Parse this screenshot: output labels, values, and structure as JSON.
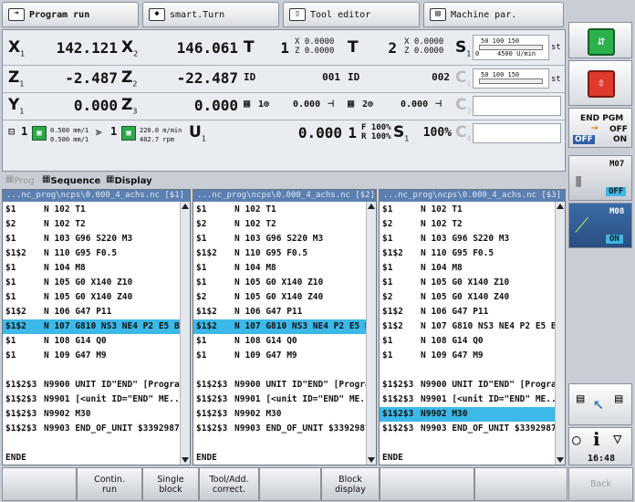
{
  "tabs": [
    {
      "label": "Program run",
      "icon": "arrow-right-icon",
      "active": true
    },
    {
      "label": "smart.Turn",
      "icon": "diamond-arrow-icon",
      "active": false
    },
    {
      "label": "Tool editor",
      "icon": "tool-icon",
      "active": false
    },
    {
      "label": "Machine par.",
      "icon": "machine-icon",
      "active": false
    }
  ],
  "positions": {
    "row1": {
      "axis1": "X",
      "sub1": "1",
      "val1": "142.121",
      "axis2": "X",
      "sub2": "2",
      "val2": "146.061",
      "t1_label": "T",
      "t1_val": "1",
      "t1_xz_x": "X",
      "t1_x": "0.0000",
      "t1_xz_z": "Z",
      "t1_z": "0.0000",
      "t2_label": "T",
      "t2_val": "2",
      "t2_xz_x": "X",
      "t2_x": "0.0000",
      "t2_xz_z": "Z",
      "t2_z": "0.0000",
      "s_label": "S",
      "s_sub": "1",
      "s_scale": "50  100  150",
      "s_unit": "st",
      "s_speed": "0",
      "s_rpm": "4500 U/min"
    },
    "row2": {
      "axis1": "Z",
      "sub1": "1",
      "val1": "-2.487",
      "axis2": "Z",
      "sub2": "2",
      "val2": "-22.487",
      "id1_label": "ID",
      "id1_val": "001",
      "id2_label": "ID",
      "id2_val": "002",
      "c_label": "C",
      "c_sub": "1",
      "c_scale": "50  100  150",
      "c_unit": "st"
    },
    "row3": {
      "axis1": "Y",
      "sub1": "1",
      "val1": "0.000",
      "axis2": "Z",
      "sub2": "3",
      "val2": "0.000",
      "ch1": "1",
      "ch1_val": "0.000",
      "ch2": "2",
      "ch2_val": "0.000",
      "c_label": "C",
      "c_sub": "2"
    },
    "row4": {
      "ch": "1",
      "feed1": "0.500 mm/1",
      "feed2": "0.500 mm/1",
      "ch2": "1",
      "cut1": "220.0 m/min",
      "cut2": "402.7 rpm",
      "u_label": "U",
      "u_sub": "1",
      "u_val": "0.000",
      "ovr_ch": "1",
      "f_label": "F",
      "f_ovr": "100%",
      "r_label": "R",
      "r_ovr": "100%",
      "s_label": "S",
      "s_sub": "1",
      "s_ovr": "100%",
      "c_label": "C",
      "c_sub": "4"
    }
  },
  "mode": {
    "prog": "Prog",
    "sequence": "Sequence",
    "display": "Display"
  },
  "panes": [
    {
      "title": "...nc_prog\\ncps\\0.000_4_achs.nc [$1]",
      "lines": [
        [
          "$1",
          "N 102 T1"
        ],
        [
          "$2",
          "N 102 T2"
        ],
        [
          "$1",
          "N 103 G96 S220 M3"
        ],
        [
          "$1$2",
          "N 110 G95 F0.5"
        ],
        [
          "$1",
          "N 104 M8"
        ],
        [
          "$1",
          "N 105 G0 X140 Z10"
        ],
        [
          "$1",
          "N 105 G0 X140 Z40"
        ],
        [
          "$1$2",
          "N 106 G47 P11"
        ],
        [
          "$1$2",
          "N 107 G810 NS3 NE4 P2 E5 B..."
        ],
        [
          "$1",
          "N 108 G14 Q0"
        ],
        [
          "$1",
          "N 109 G47 M9"
        ],
        [
          "",
          ""
        ],
        [
          "$1$2$3",
          "N9900 UNIT ID\"END\" [Progra..."
        ],
        [
          "$1$2$3",
          "N9901   [<unit ID=\"END\" ME..."
        ],
        [
          "$1$2$3",
          "N9902   M30"
        ],
        [
          "$1$2$3",
          "N9903 END_OF_UNIT $3392987..."
        ],
        [
          "",
          ""
        ],
        [
          "ENDE",
          ""
        ]
      ],
      "selected": 8
    },
    {
      "title": "...nc_prog\\ncps\\0.000_4_achs.nc [$2]",
      "lines": [
        [
          "$1",
          "N 102 T1"
        ],
        [
          "$2",
          "N 102 T2"
        ],
        [
          "$1",
          "N 103 G96 S220 M3"
        ],
        [
          "$1$2",
          "N 110 G95 F0.5"
        ],
        [
          "$1",
          "N 104 M8"
        ],
        [
          "$1",
          "N 105 G0 X140 Z10"
        ],
        [
          "$2",
          "N 105 G0 X140 Z40"
        ],
        [
          "$1$2",
          "N 106 G47 P11"
        ],
        [
          "$1$2",
          "N 107 G810 NS3 NE4 P2 E5 B..."
        ],
        [
          "$1",
          "N 108 G14 Q0"
        ],
        [
          "$1",
          "N 109 G47 M9"
        ],
        [
          "",
          ""
        ],
        [
          "$1$2$3",
          "N9900 UNIT ID\"END\" [Progra..."
        ],
        [
          "$1$2$3",
          "N9901   [<unit ID=\"END\" ME..."
        ],
        [
          "$1$2$3",
          "N9902   M30"
        ],
        [
          "$1$2$3",
          "N9903 END_OF_UNIT $3392987..."
        ],
        [
          "",
          ""
        ],
        [
          "ENDE",
          ""
        ]
      ],
      "selected": 8
    },
    {
      "title": "...nc_prog\\ncps\\0.000_4_achs.nc [$3]",
      "lines": [
        [
          "$1",
          "N 102 T1"
        ],
        [
          "$2",
          "N 102 T2"
        ],
        [
          "$1",
          "N 103 G96 S220 M3"
        ],
        [
          "$1$2",
          "N 110 G95 F0.5"
        ],
        [
          "$1",
          "N 104 M8"
        ],
        [
          "$1",
          "N 105 G0 X140 Z10"
        ],
        [
          "$2",
          "N 105 G0 X140 Z40"
        ],
        [
          "$1$2",
          "N 106 G47 P11"
        ],
        [
          "$1$2",
          "N 107 G810 NS3 NE4 P2 E5 B..."
        ],
        [
          "$1",
          "N 108 G14 Q0"
        ],
        [
          "$1",
          "N 109 G47 M9"
        ],
        [
          "",
          ""
        ],
        [
          "$1$2$3",
          "N9900 UNIT ID\"END\" [Progra..."
        ],
        [
          "$1$2$3",
          "N9901   [<unit ID=\"END\" ME..."
        ],
        [
          "$1$2$3",
          "N9902   M30"
        ],
        [
          "$1$2$3",
          "N9903 END_OF_UNIT $3392987..."
        ],
        [
          "",
          ""
        ],
        [
          "ENDE",
          ""
        ]
      ],
      "selected": 14
    }
  ],
  "softkeys": [
    "",
    "Contin.\nrun",
    "Single\nblock",
    "Tool/Add.\ncorrect.",
    "",
    "Block\ndisplay",
    "",
    "",
    "Back"
  ],
  "right": {
    "endpgm": "END PGM",
    "endpgm_off": "OFF",
    "off": "OFF",
    "on": "ON",
    "m07": "M07",
    "m07_state": "OFF",
    "m08": "M08",
    "m08_state": "ON",
    "time": "16:48",
    "info": "i"
  }
}
